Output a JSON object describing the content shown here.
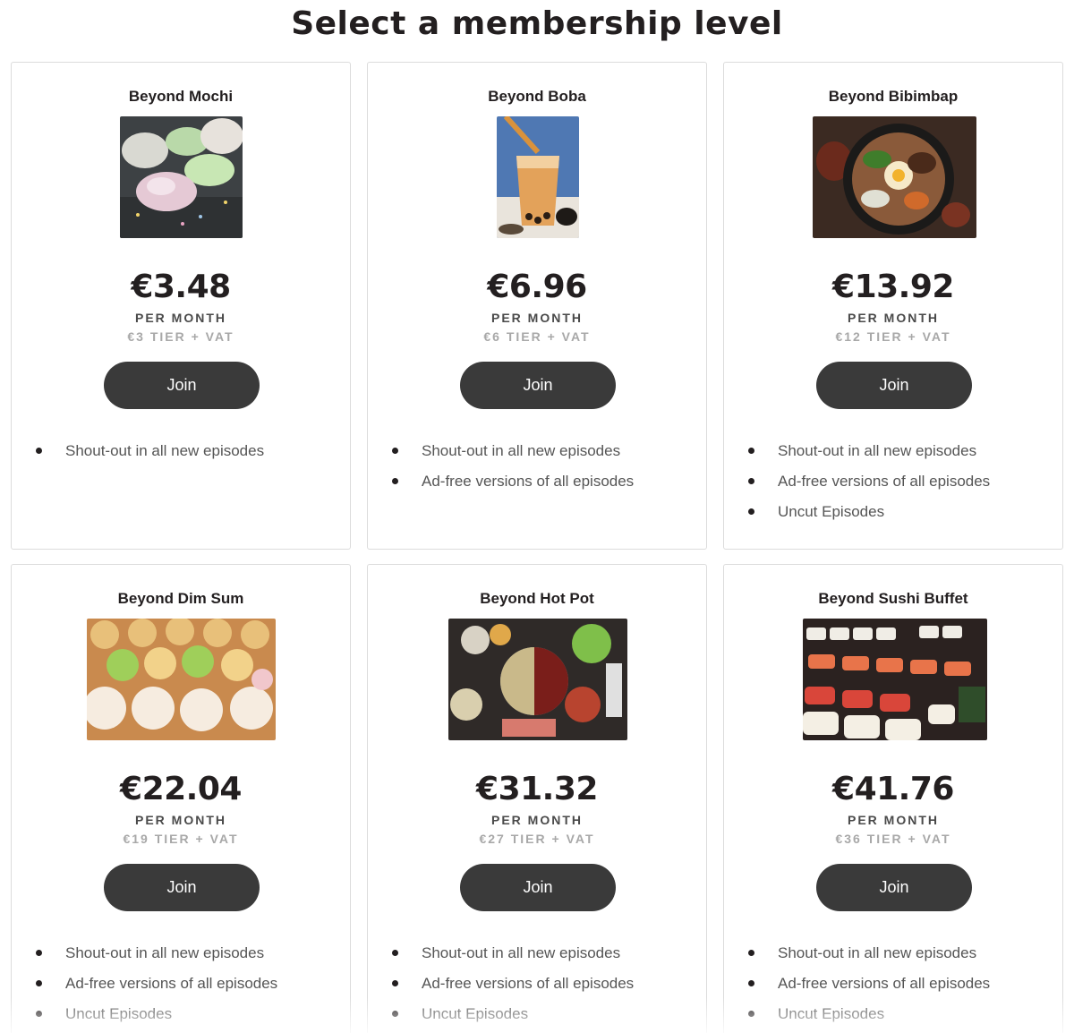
{
  "page": {
    "title": "Select a membership level"
  },
  "tiers": [
    {
      "name": "Beyond Mochi",
      "image": "mochi-photo",
      "price": "€3.48",
      "per_month": "PER MONTH",
      "tier_vat": "€3 TIER + VAT",
      "join_label": "Join",
      "benefits": [
        "Shout-out in all new episodes"
      ]
    },
    {
      "name": "Beyond Boba",
      "image": "boba-photo",
      "price": "€6.96",
      "per_month": "PER MONTH",
      "tier_vat": "€6 TIER + VAT",
      "join_label": "Join",
      "benefits": [
        "Shout-out in all new episodes",
        "Ad-free versions of all episodes"
      ]
    },
    {
      "name": "Beyond Bibimbap",
      "image": "bibimbap-photo",
      "price": "€13.92",
      "per_month": "PER MONTH",
      "tier_vat": "€12 TIER + VAT",
      "join_label": "Join",
      "benefits": [
        "Shout-out in all new episodes",
        "Ad-free versions of all episodes",
        "Uncut Episodes"
      ]
    },
    {
      "name": "Beyond Dim Sum",
      "image": "dim-sum-photo",
      "price": "€22.04",
      "per_month": "PER MONTH",
      "tier_vat": "€19 TIER + VAT",
      "join_label": "Join",
      "benefits": [
        "Shout-out in all new episodes",
        "Ad-free versions of all episodes",
        "Uncut Episodes"
      ]
    },
    {
      "name": "Beyond Hot Pot",
      "image": "hot-pot-photo",
      "price": "€31.32",
      "per_month": "PER MONTH",
      "tier_vat": "€27 TIER + VAT",
      "join_label": "Join",
      "benefits": [
        "Shout-out in all new episodes",
        "Ad-free versions of all episodes",
        "Uncut Episodes"
      ]
    },
    {
      "name": "Beyond Sushi Buffet",
      "image": "sushi-buffet-photo",
      "price": "€41.76",
      "per_month": "PER MONTH",
      "tier_vat": "€36 TIER + VAT",
      "join_label": "Join",
      "benefits": [
        "Shout-out in all new episodes",
        "Ad-free versions of all episodes",
        "Uncut Episodes"
      ]
    }
  ],
  "colors": {
    "button": "#3a3a3a",
    "text": "#231f20",
    "muted": "#a8a8a8"
  }
}
